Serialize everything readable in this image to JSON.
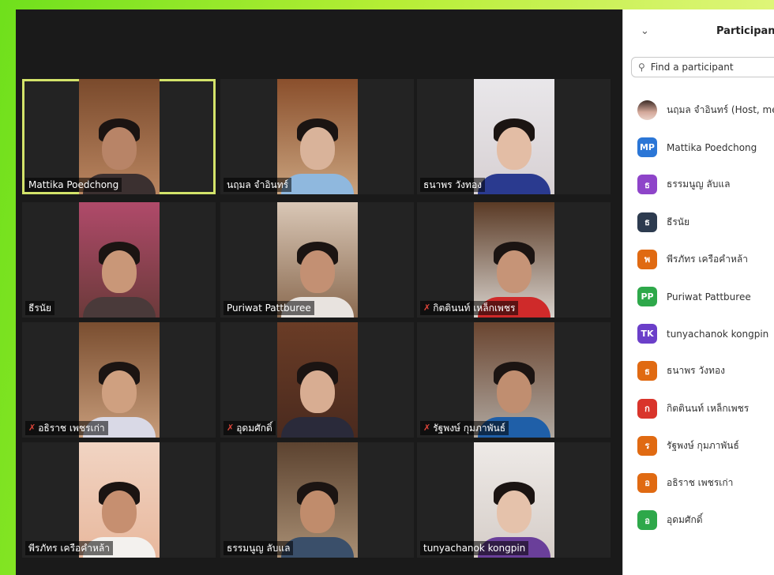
{
  "panel": {
    "title": "Participants",
    "search_placeholder": "Find a participant",
    "participants": [
      {
        "name": "นฤมล จำอินทร์ (Host, me)",
        "initials": "",
        "color": ""
      },
      {
        "name": "Mattika Poedchong",
        "initials": "MP",
        "color": "#2b76d6"
      },
      {
        "name": "ธรรมนูญ ลับแล",
        "initials": "ธ",
        "color": "#8e44c9"
      },
      {
        "name": "ธีรนัย",
        "initials": "ธ",
        "color": "#2d3b4f"
      },
      {
        "name": "พีรภัทร เครือคำหล้า",
        "initials": "พ",
        "color": "#e06a12"
      },
      {
        "name": "Puriwat Pattburee",
        "initials": "PP",
        "color": "#2ea84a"
      },
      {
        "name": "tunyachanok kongpin",
        "initials": "TK",
        "color": "#6b3fc9"
      },
      {
        "name": "ธนาพร วังทอง",
        "initials": "ธ",
        "color": "#e06a12"
      },
      {
        "name": "กิตตินนท์ เหล็กเพชร",
        "initials": "ก",
        "color": "#d9342b"
      },
      {
        "name": "รัฐพงษ์ กุมภาพันธ์",
        "initials": "ร",
        "color": "#e06a12"
      },
      {
        "name": "อธิราช เพชรเก่า",
        "initials": "อ",
        "color": "#e06a12"
      },
      {
        "name": "อุดมศักดิ์",
        "initials": "อ",
        "color": "#2ea84a"
      }
    ]
  },
  "gallery": [
    {
      "name": "Mattika Poedchong",
      "muted": false,
      "active": true,
      "bg1": "#7a4a2c",
      "bg2": "#b98560",
      "skin": "#b88467",
      "shirt": "#3b3030"
    },
    {
      "name": "นฤมล จำอินทร์",
      "muted": false,
      "active": false,
      "bg1": "#8a4f2c",
      "bg2": "#c9a27d",
      "skin": "#d9b39a",
      "shirt": "#8fb8de"
    },
    {
      "name": "ธนาพร วังทอง",
      "muted": false,
      "active": false,
      "bg1": "#e9e7ea",
      "bg2": "#d7d0d3",
      "skin": "#e3bda5",
      "shirt": "#2a3a8f"
    },
    {
      "name": "ธีรนัย",
      "muted": false,
      "active": false,
      "bg1": "#b04a6a",
      "bg2": "#6b3a3a",
      "skin": "#c99778",
      "shirt": "#4a3a3a"
    },
    {
      "name": "Puriwat Pattburee",
      "muted": false,
      "active": false,
      "bg1": "#d9c7b6",
      "bg2": "#8a6a50",
      "skin": "#c39073",
      "shirt": "#e8e3df"
    },
    {
      "name": "กิตตินนท์ เหล็กเพชร",
      "muted": true,
      "active": false,
      "bg1": "#5a3a25",
      "bg2": "#d8d2cc",
      "skin": "#c69477",
      "shirt": "#cf2a2a"
    },
    {
      "name": "อธิราช เพชรเก่า",
      "muted": true,
      "active": false,
      "bg1": "#7a4e30",
      "bg2": "#c79c7a",
      "skin": "#cfa080",
      "shirt": "#d9d9e6"
    },
    {
      "name": "อุดมศักดิ์",
      "muted": true,
      "active": false,
      "bg1": "#6a3c26",
      "bg2": "#4a2a1e",
      "skin": "#d8ad92",
      "shirt": "#2a2a3a"
    },
    {
      "name": "รัฐพงษ์ กุมภาพันธ์",
      "muted": true,
      "active": false,
      "bg1": "#6a4530",
      "bg2": "#b0a8a0",
      "skin": "#c08e70",
      "shirt": "#1f5fa8"
    },
    {
      "name": "พีรภัทร เครือคำหล้า",
      "muted": false,
      "active": false,
      "bg1": "#f1d4c3",
      "bg2": "#e8b89d",
      "skin": "#c68f70",
      "shirt": "#f3f1ee"
    },
    {
      "name": "ธรรมนูญ ลับแล",
      "muted": false,
      "active": false,
      "bg1": "#5c4330",
      "bg2": "#a88e73",
      "skin": "#c08c6c",
      "shirt": "#3a4f6a"
    },
    {
      "name": "tunyachanok kongpin",
      "muted": false,
      "active": false,
      "bg1": "#eeeae7",
      "bg2": "#d5cdc8",
      "skin": "#e5c2ab",
      "shirt": "#6a3f9a"
    }
  ]
}
